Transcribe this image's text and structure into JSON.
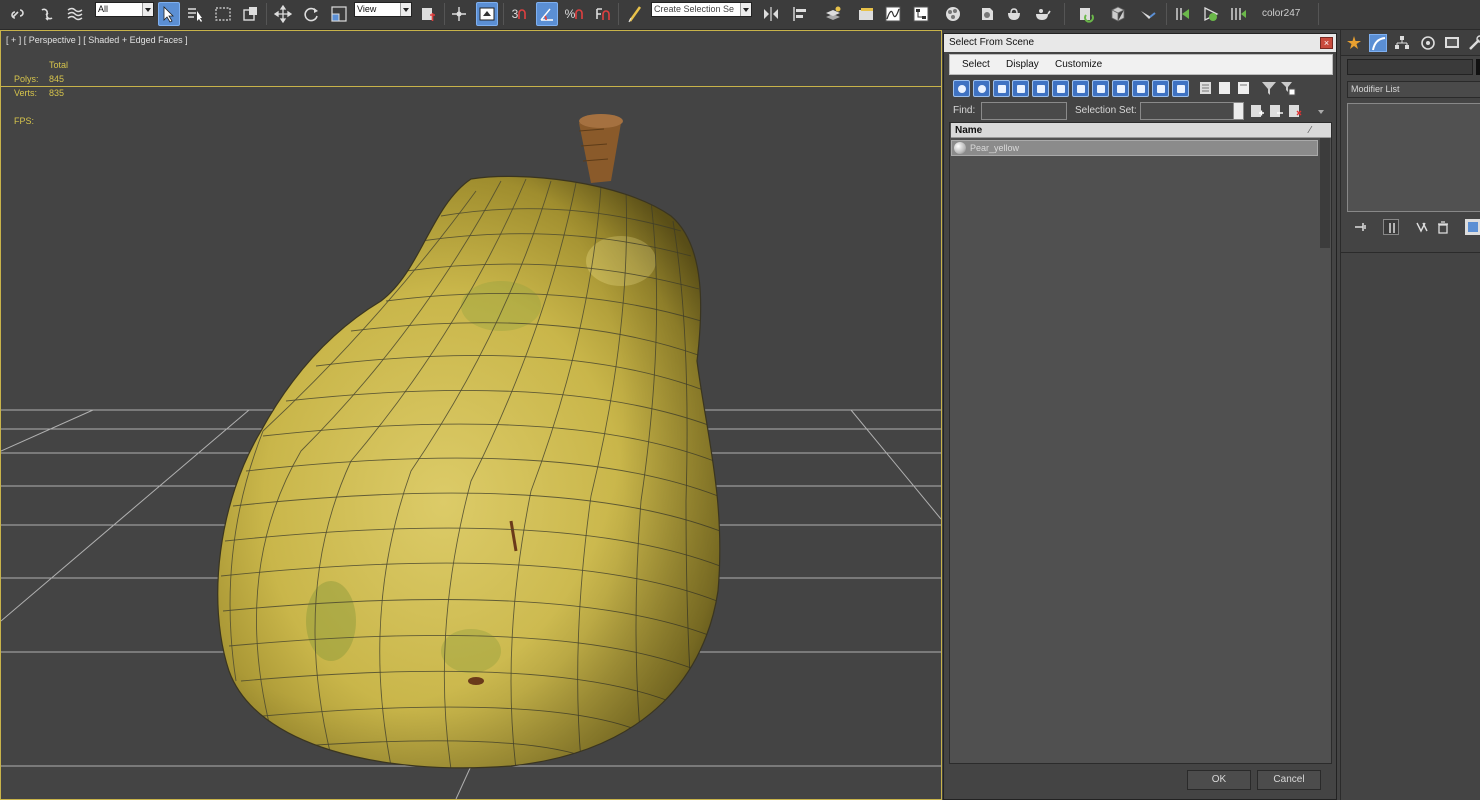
{
  "toolbar": {
    "selection_filter": "All",
    "reference_coord": "View",
    "named_selection_placeholder": "Create Selection Se",
    "snap_3d": "3",
    "angle_snap": "%",
    "color_label": "color247"
  },
  "viewport": {
    "label": "[ + ] [ Perspective ] [ Shaded + Edged Faces ]",
    "stats": {
      "total_label": "Total",
      "polys_label": "Polys:",
      "polys_value": "845",
      "verts_label": "Verts:",
      "verts_value": "835",
      "fps_label": "FPS:"
    }
  },
  "dialog": {
    "title": "Select From Scene",
    "close_glyph": "×",
    "menu": [
      "Select",
      "Display",
      "Customize"
    ],
    "find_label": "Find:",
    "selection_set_label": "Selection Set:",
    "list_header": "Name",
    "sort_glyph": "⁄",
    "objects": [
      "Pear_yellow"
    ],
    "ok_label": "OK",
    "cancel_label": "Cancel"
  },
  "command_panel": {
    "modifier_list_label": "Modifier List"
  },
  "colors": {
    "viewport_bg": "#444444",
    "viewport_border": "#c8b34a",
    "stats_text": "#d6c44c",
    "pear_yellow": "#c9b64a",
    "active_blue": "#5b8fd4"
  }
}
